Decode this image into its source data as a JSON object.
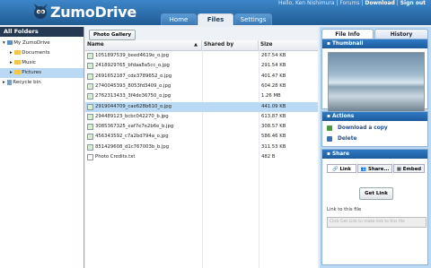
{
  "header": {
    "logo": "ZumoDrive",
    "user_text": "Hello, Ken Nishimura | Forums |",
    "download": "Download",
    "sep": "|",
    "signout": "Sign out",
    "tabs": [
      "Home",
      "Files",
      "Settings"
    ],
    "active_tab": "Files"
  },
  "sidebar": {
    "title": "All Folders",
    "items": [
      "My ZumoDrive",
      "Documents",
      "Music",
      "Pictures",
      "Recycle bin"
    ]
  },
  "toolbar": {
    "gallery": "Photo Gallery"
  },
  "table": {
    "columns": {
      "name": "Name",
      "shared": "Shared by",
      "size": "Size",
      "sort": "▲"
    },
    "rows": [
      {
        "name": "1051897539_beed4619e_o.jpg",
        "size": "267.54 KB"
      },
      {
        "name": "2418929765_bfdaa8a5cc_o.jpg",
        "size": "291.54 KB"
      },
      {
        "name": "2691652187_cde3789652_o.jpg",
        "size": "401.47 KB"
      },
      {
        "name": "2740045393_8053fd3409_o.jpg",
        "size": "604.28 KB"
      },
      {
        "name": "2762313433_3f4de36750_o.jpg",
        "size": "1.26 MB"
      },
      {
        "name": "2919044709_cae628b610_o.jpg",
        "size": "441.09 KB"
      },
      {
        "name": "294489123_bcbc042270_b.jpg",
        "size": "613.87 KB"
      },
      {
        "name": "3085367325_eaf7e7e2b6e_b.jpg",
        "size": "308.57 KB"
      },
      {
        "name": "456343592_c7a2bd794a_o.jpg",
        "size": "586.46 KB"
      },
      {
        "name": "851429608_d1c767003b_b.jpg",
        "size": "311.53 KB"
      },
      {
        "name": "Photo Credits.txt",
        "size": "482 B"
      }
    ]
  },
  "right": {
    "tabs": [
      "File Info",
      "History"
    ],
    "thumbnail_title": "Thumbnail",
    "actions_title": "Actions",
    "actions": [
      "Download a copy",
      "Delete"
    ],
    "share_title": "Share",
    "share_tabs": [
      "Link",
      "Share...",
      "Embed"
    ],
    "get_link": "Get Link",
    "link_label": "Link to this file",
    "link_placeholder": "Click Get Link to make link to this file"
  },
  "colors": {
    "header": "#2f6ea8",
    "panel": "#b9d9f4",
    "selected_row": "#b9d9f4",
    "dark_head": "#253a52"
  }
}
